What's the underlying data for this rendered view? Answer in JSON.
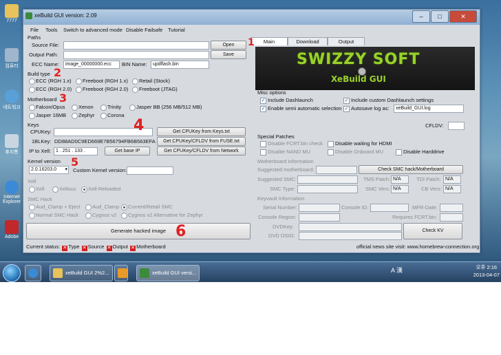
{
  "desktop": {
    "icons": [
      "7777",
      "컴퓨터",
      "네트워크",
      "휴지통",
      "Internet Explorer",
      "Adobe"
    ]
  },
  "window": {
    "title": "xeBuild GUI version: 2.09",
    "menu": [
      "File",
      "Tools",
      "Switch to advanced mode",
      "Disable Failsafe",
      "Tutorial"
    ]
  },
  "paths": {
    "heading": "Paths",
    "source_label": "Source File:",
    "source_value": "",
    "output_label": "Output Path:",
    "output_value": "",
    "ecc_label": "ECC Name:",
    "ecc_value": "image_00000000.ecc",
    "bin_label": "BIN Name:",
    "bin_value": "updflash.bin",
    "open_button": "Open",
    "save_button": "Save"
  },
  "build_type": {
    "heading": "Build type",
    "options": [
      "ECC (RGH 1.x)",
      "Freeboot (RGH 1.x)",
      "Retail (Stock)",
      "ECC (RGH 2.0)",
      "Freeboot (RGH 2.0)",
      "Freeboot (JTAG)"
    ]
  },
  "motherboard": {
    "heading": "Motherboard",
    "options": [
      "Falcon/Opus",
      "Xenon",
      "Trinity",
      "Jasper BB (256 MB/512 MB)",
      "Jasper 16MB",
      "Zephyr",
      "Corona"
    ]
  },
  "keys": {
    "heading": "Keys",
    "cpukey_label": "CPUKey:",
    "cpukey_value": "",
    "onebl_label": "1BLKey:",
    "onebl_value": "DD88AD0C9ED669E7B56794FB6B563EFA",
    "ip_label": "IP to Xell:",
    "ip_value": "1 . 251 . 133 .",
    "btn_get_cpukey_txt": "Get CPUKey from Keys.txt",
    "btn_fuse": "Get CPUKey/CFLDV from FUSE.txt",
    "btn_network": "Get CPUKey/CFLDV from Network",
    "btn_base_ip": "Get base IP"
  },
  "kernel": {
    "heading": "Kernel version",
    "selected": "2.0.16203.0",
    "custom_label": "Custom Kernel version:"
  },
  "xell": {
    "heading": "Xell",
    "options": [
      "Xell",
      "Xellous",
      "Xell-Reloaded"
    ]
  },
  "smc_hack": {
    "heading": "SMC Hack",
    "options": [
      "Aud_Clamp + Eject",
      "Aud_Clamp",
      "Current/Retail SMC",
      "Normal SMC Hack",
      "Cygnos v2",
      "Cygnos v2 Alternative for Zephyr"
    ]
  },
  "generate_button": "Generate hacked image",
  "tabs": [
    "Main",
    "Download",
    "Output"
  ],
  "logo": {
    "line1": "SWIZZY SOFT",
    "line2": "XeBuild GUI"
  },
  "misc": {
    "heading": "Misc options",
    "include_dashlaunch": "Include Dashlaunch",
    "include_custom": "Include custom Dashlaunch settings",
    "semi_auto": "Enable semi automatic selection",
    "autosave": "Autosave log as:",
    "log_value": "xeBuild_GUI.log",
    "cfldv_label": "CFLDV:"
  },
  "special": {
    "heading": "Special Patches",
    "options": [
      "Disable FCRT.bin check",
      "Disable waiting for HDMI",
      "Disable NAND MU",
      "Disable Onboard MU",
      "Disable Harddrive"
    ]
  },
  "mb_info": {
    "heading": "Motherboard information",
    "suggested_mb": "Suggested motherboard:",
    "check_button": "Check SMC hack/Motherboard",
    "suggested_smc": "Suggested SMC:",
    "tms": "TMS Patch:",
    "tdi": "TDI Patch:",
    "smc_type": "SMC Type:",
    "smc_vers": "SMC Vers:",
    "cb_vers": "CB Vers:",
    "na": "N/A"
  },
  "keyvault": {
    "heading": "Keyvault Information",
    "serial": "Serial Number:",
    "console_id": "Console ID:",
    "mfr": "MFR-Date:",
    "region": "Console Region:",
    "fcrt": "Requires FCRT.bin:",
    "dvdkey": "DVDKey:",
    "osig": "DVD OSIG:",
    "check_kv": "Check KV"
  },
  "status": {
    "label": "Current status:",
    "items": [
      "Type",
      "Source",
      "Output",
      "Motherboard"
    ],
    "site": "official news site visit: www.homebrew-connection.org"
  },
  "taskbar": {
    "items": [
      "xeBuild GUI 2%2...",
      "",
      "xeBuild GUI versi..."
    ],
    "tray_text": "A 漢",
    "time": "오후 2:16",
    "date": "2013-04-07"
  },
  "annotations": [
    "1",
    "2",
    "3",
    "4",
    "5",
    "6"
  ],
  "colors": {
    "annotation": "#e02020",
    "logo_green": "#9ad22a",
    "status_x": "#d02020"
  }
}
